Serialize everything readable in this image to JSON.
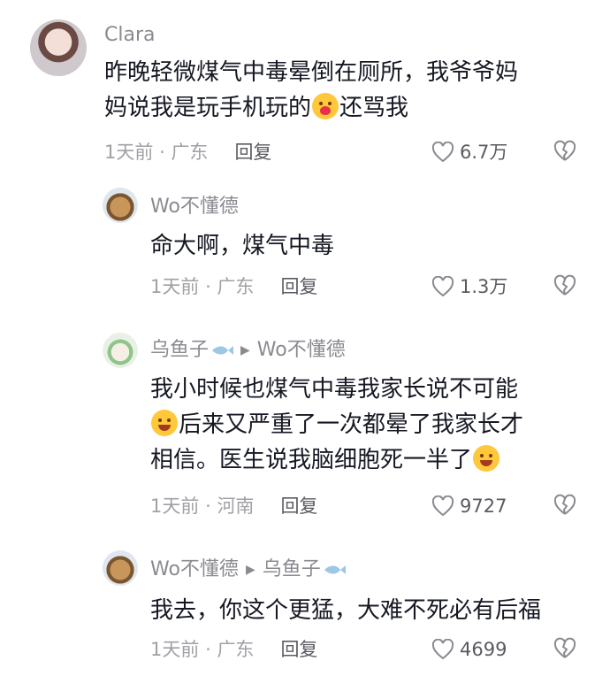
{
  "comments": [
    {
      "user": "Clara",
      "text_before": "昨晚轻微煤气中毒晕倒在厕所，我爷爷妈",
      "text_line2": "妈说我是玩手机玩的",
      "text_after": "还骂我",
      "emoji": "hug-emoji",
      "time": "1天前",
      "location": "广东",
      "reply": "回复",
      "likes": "6.7万"
    },
    {
      "user": "Wo不懂德",
      "text": "命大啊，煤气中毒",
      "time": "1天前",
      "location": "广东",
      "reply": "回复",
      "likes": "1.3万"
    },
    {
      "user": "乌鱼子",
      "reply_to": "Wo不懂德",
      "line1": "我小时候也煤气中毒我家长说不可能",
      "line2": "后来又严重了一次都晕了我家长才",
      "line3": "相信。医生说我脑细胞死一半了",
      "emoji1": "laugh-sweat-emoji",
      "emoji2": "wink-tongue-emoji",
      "time": "1天前",
      "location": "河南",
      "reply": "回复",
      "likes": "9727"
    },
    {
      "user": "Wo不懂德",
      "reply_to": "乌鱼子",
      "text": "我去，你这个更猛，大难不死必有后福",
      "time": "1天前",
      "location": "广东",
      "reply": "回复",
      "likes": "4699"
    }
  ],
  "separator": "·"
}
